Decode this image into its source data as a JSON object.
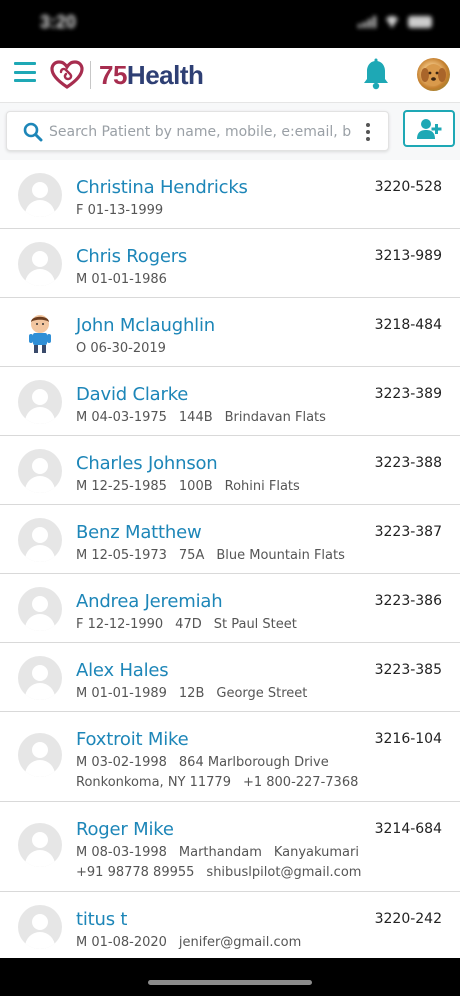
{
  "status_bar": {
    "time": "3:20"
  },
  "header": {
    "brand_number": "75",
    "brand_word": "Health"
  },
  "search": {
    "placeholder": "Search Patient by name, mobile, e:email, bir"
  },
  "colors": {
    "accent": "#1ea8b5",
    "name_blue": "#1d86b8",
    "brand_red": "#a72d4f",
    "brand_navy": "#2e3f74"
  },
  "patients": [
    {
      "name": "Christina Hendricks",
      "id": "3220-528",
      "line1": [
        "F 01-13-1999"
      ],
      "line2": []
    },
    {
      "name": "Chris Rogers",
      "id": "3213-989",
      "line1": [
        "M 01-01-1986"
      ],
      "line2": []
    },
    {
      "name": "John Mclaughlin",
      "id": "3218-484",
      "line1": [
        "O 06-30-2019"
      ],
      "line2": [],
      "avatar": "kid"
    },
    {
      "name": "David Clarke",
      "id": "3223-389",
      "line1": [
        "M 04-03-1975",
        "144B",
        "Brindavan Flats"
      ],
      "line2": []
    },
    {
      "name": "Charles Johnson",
      "id": "3223-388",
      "line1": [
        "M 12-25-1985",
        "100B",
        "Rohini Flats"
      ],
      "line2": []
    },
    {
      "name": "Benz Matthew",
      "id": "3223-387",
      "line1": [
        "M 12-05-1973",
        "75A",
        "Blue Mountain Flats"
      ],
      "line2": []
    },
    {
      "name": "Andrea Jeremiah",
      "id": "3223-386",
      "line1": [
        "F 12-12-1990",
        "47D",
        "St Paul Steet"
      ],
      "line2": []
    },
    {
      "name": "Alex Hales",
      "id": "3223-385",
      "line1": [
        "M 01-01-1989",
        "12B",
        "George Street"
      ],
      "line2": []
    },
    {
      "name": "Foxtroit Mike",
      "id": "3216-104",
      "line1": [
        "M 03-02-1998",
        "864 Marlborough Drive"
      ],
      "line2": [
        "Ronkonkoma, NY 11779",
        "+1 800-227-7368"
      ]
    },
    {
      "name": "Roger Mike",
      "id": "3214-684",
      "line1": [
        "M 08-03-1998",
        "Marthandam",
        "Kanyakumari"
      ],
      "line2": [
        "+91 98778 89955",
        "shibuslpilot@gmail.com"
      ]
    },
    {
      "name": "titus t",
      "id": "3220-242",
      "line1": [
        "M 01-08-2020",
        "jenifer@gmail.com"
      ],
      "line2": []
    }
  ]
}
